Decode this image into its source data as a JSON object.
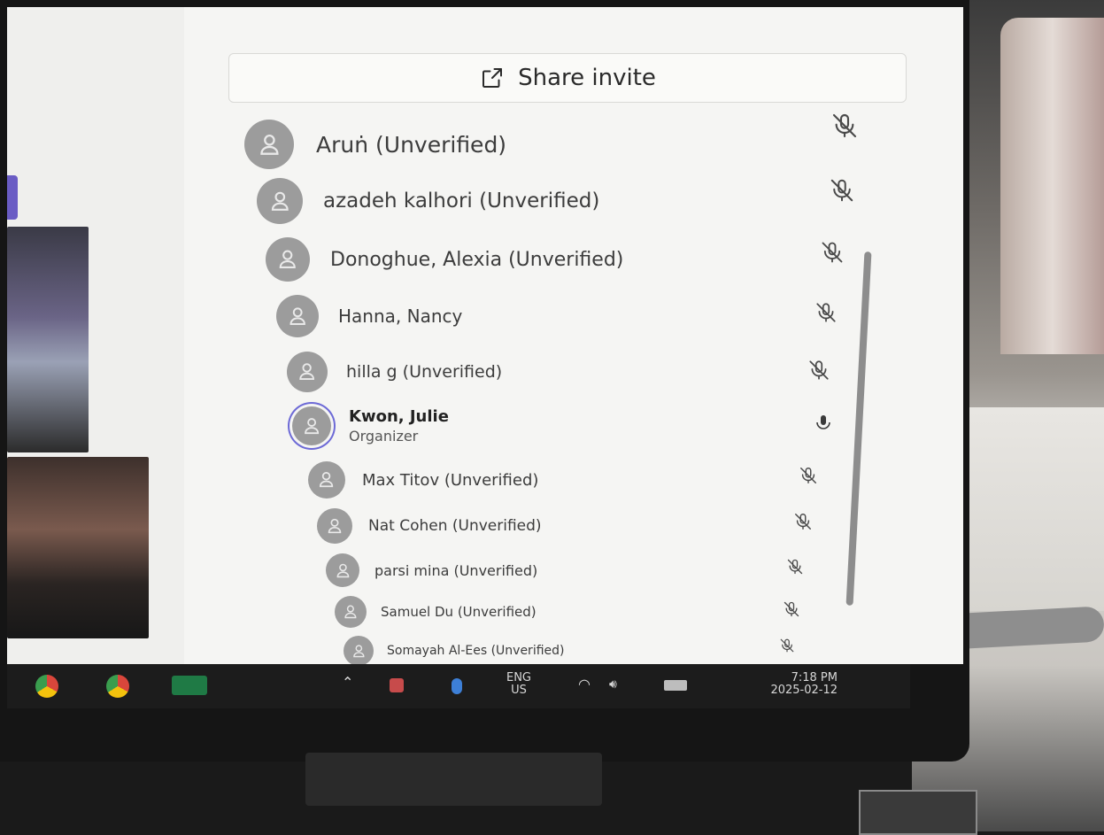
{
  "panel": {
    "share_label": "Share invite",
    "share_icon": "share-icon",
    "participants": [
      {
        "name": "Aruṅ (Unverified)",
        "mic": "mic-off-icon"
      },
      {
        "name": "azadeh kalhori (Unverified)",
        "mic": "mic-off-icon"
      },
      {
        "name": "Donoghue, Alexia (Unverified)",
        "mic": "mic-off-icon"
      },
      {
        "name": "Hanna, Nancy",
        "mic": "mic-off-icon"
      },
      {
        "name": "hilla g (Unverified)",
        "mic": "mic-off-icon"
      },
      {
        "name": "Kwon, Julie",
        "role": "Organizer",
        "mic": "mic-on-icon"
      },
      {
        "name": "Max Titov (Unverified)",
        "mic": "mic-off-icon"
      },
      {
        "name": "Nat Cohen (Unverified)",
        "mic": "mic-off-icon"
      },
      {
        "name": "parsi mina (Unverified)",
        "mic": "mic-off-icon"
      },
      {
        "name": "Samuel Du (Unverified)",
        "mic": "mic-off-icon"
      },
      {
        "name": "Somayah Al-Ees (Unverified)",
        "mic": "mic-off-icon"
      }
    ]
  },
  "taskbar": {
    "apps": [
      "chrome-icon",
      "chrome-icon",
      "excel-icon"
    ],
    "language_line1": "ENG",
    "language_line2": "US",
    "time": "7:18 PM",
    "date": "2025-02-12"
  },
  "colors": {
    "organizer_ring": "#6d6ad6",
    "avatar": "#9c9c9c"
  }
}
